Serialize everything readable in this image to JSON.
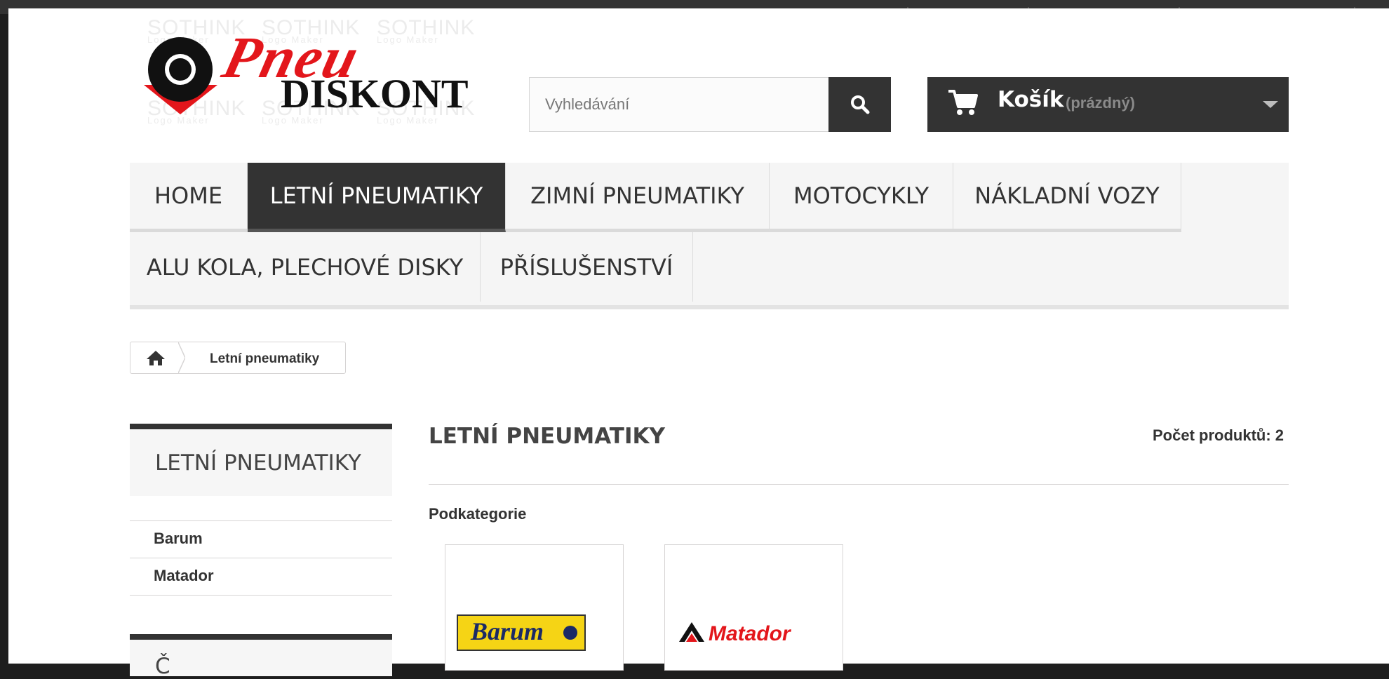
{
  "header": {
    "logo": {
      "name": "pneu-diskont-logo",
      "line1": "Pneu",
      "line2": "DISKONT",
      "watermark_text": "SOTHINK",
      "watermark_sub": "Logo Maker"
    },
    "search": {
      "placeholder": "Vyhledávání",
      "value": "",
      "button_icon": "search-icon"
    },
    "cart": {
      "label": "Košík",
      "status": "(prázdný)",
      "icon": "cart-icon"
    }
  },
  "menu": {
    "items": [
      {
        "label": "HOME",
        "active": false
      },
      {
        "label": "LETNÍ PNEUMATIKY",
        "active": true
      },
      {
        "label": "ZIMNÍ PNEUMATIKY",
        "active": false
      },
      {
        "label": "MOTOCYKLY",
        "active": false
      },
      {
        "label": "NÁKLADNÍ VOZY",
        "active": false
      },
      {
        "label": "ALU KOLA, PLECHOVÉ DISKY",
        "active": false
      },
      {
        "label": "PŘÍSLUŠENSTVÍ",
        "active": false
      }
    ]
  },
  "breadcrumb": {
    "home_icon": "home-icon",
    "current": "Letní pneumatiky"
  },
  "sidebar": {
    "title": "LETNÍ PNEUMATIKY",
    "items": [
      {
        "label": "Barum"
      },
      {
        "label": "Matador"
      }
    ],
    "second_block_title_fragment": "Č"
  },
  "main": {
    "title": "LETNÍ PNEUMATIKY",
    "product_count": "Počet produktů: 2",
    "subcategories_heading": "Podkategorie",
    "subcategories": [
      {
        "name": "Barum",
        "logo_text": "Barum"
      },
      {
        "name": "Matador",
        "logo_text": "Matador"
      }
    ]
  },
  "colors": {
    "dark": "#333333",
    "brand_red": "#e3161b",
    "menu_bg": "#f5f5f5",
    "barum_yellow": "#f5d415",
    "barum_blue": "#1b2a66"
  }
}
